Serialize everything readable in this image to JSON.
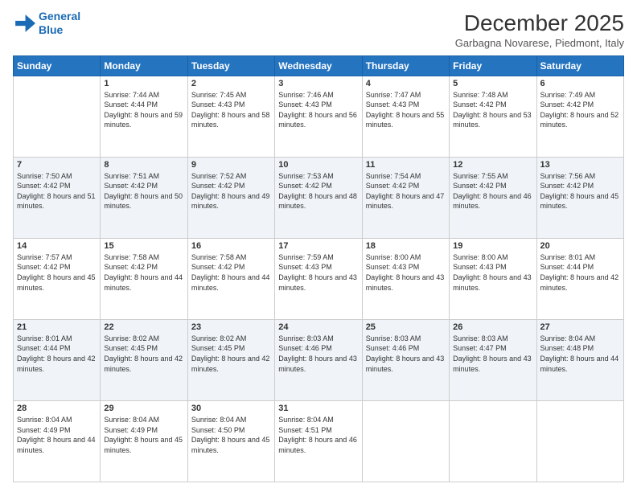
{
  "logo": {
    "line1": "General",
    "line2": "Blue"
  },
  "title": "December 2025",
  "subtitle": "Garbagna Novarese, Piedmont, Italy",
  "days_of_week": [
    "Sunday",
    "Monday",
    "Tuesday",
    "Wednesday",
    "Thursday",
    "Friday",
    "Saturday"
  ],
  "weeks": [
    [
      {
        "day": "",
        "sunrise": "",
        "sunset": "",
        "daylight": ""
      },
      {
        "day": "1",
        "sunrise": "Sunrise: 7:44 AM",
        "sunset": "Sunset: 4:44 PM",
        "daylight": "Daylight: 8 hours and 59 minutes."
      },
      {
        "day": "2",
        "sunrise": "Sunrise: 7:45 AM",
        "sunset": "Sunset: 4:43 PM",
        "daylight": "Daylight: 8 hours and 58 minutes."
      },
      {
        "day": "3",
        "sunrise": "Sunrise: 7:46 AM",
        "sunset": "Sunset: 4:43 PM",
        "daylight": "Daylight: 8 hours and 56 minutes."
      },
      {
        "day": "4",
        "sunrise": "Sunrise: 7:47 AM",
        "sunset": "Sunset: 4:43 PM",
        "daylight": "Daylight: 8 hours and 55 minutes."
      },
      {
        "day": "5",
        "sunrise": "Sunrise: 7:48 AM",
        "sunset": "Sunset: 4:42 PM",
        "daylight": "Daylight: 8 hours and 53 minutes."
      },
      {
        "day": "6",
        "sunrise": "Sunrise: 7:49 AM",
        "sunset": "Sunset: 4:42 PM",
        "daylight": "Daylight: 8 hours and 52 minutes."
      }
    ],
    [
      {
        "day": "7",
        "sunrise": "Sunrise: 7:50 AM",
        "sunset": "Sunset: 4:42 PM",
        "daylight": "Daylight: 8 hours and 51 minutes."
      },
      {
        "day": "8",
        "sunrise": "Sunrise: 7:51 AM",
        "sunset": "Sunset: 4:42 PM",
        "daylight": "Daylight: 8 hours and 50 minutes."
      },
      {
        "day": "9",
        "sunrise": "Sunrise: 7:52 AM",
        "sunset": "Sunset: 4:42 PM",
        "daylight": "Daylight: 8 hours and 49 minutes."
      },
      {
        "day": "10",
        "sunrise": "Sunrise: 7:53 AM",
        "sunset": "Sunset: 4:42 PM",
        "daylight": "Daylight: 8 hours and 48 minutes."
      },
      {
        "day": "11",
        "sunrise": "Sunrise: 7:54 AM",
        "sunset": "Sunset: 4:42 PM",
        "daylight": "Daylight: 8 hours and 47 minutes."
      },
      {
        "day": "12",
        "sunrise": "Sunrise: 7:55 AM",
        "sunset": "Sunset: 4:42 PM",
        "daylight": "Daylight: 8 hours and 46 minutes."
      },
      {
        "day": "13",
        "sunrise": "Sunrise: 7:56 AM",
        "sunset": "Sunset: 4:42 PM",
        "daylight": "Daylight: 8 hours and 45 minutes."
      }
    ],
    [
      {
        "day": "14",
        "sunrise": "Sunrise: 7:57 AM",
        "sunset": "Sunset: 4:42 PM",
        "daylight": "Daylight: 8 hours and 45 minutes."
      },
      {
        "day": "15",
        "sunrise": "Sunrise: 7:58 AM",
        "sunset": "Sunset: 4:42 PM",
        "daylight": "Daylight: 8 hours and 44 minutes."
      },
      {
        "day": "16",
        "sunrise": "Sunrise: 7:58 AM",
        "sunset": "Sunset: 4:42 PM",
        "daylight": "Daylight: 8 hours and 44 minutes."
      },
      {
        "day": "17",
        "sunrise": "Sunrise: 7:59 AM",
        "sunset": "Sunset: 4:43 PM",
        "daylight": "Daylight: 8 hours and 43 minutes."
      },
      {
        "day": "18",
        "sunrise": "Sunrise: 8:00 AM",
        "sunset": "Sunset: 4:43 PM",
        "daylight": "Daylight: 8 hours and 43 minutes."
      },
      {
        "day": "19",
        "sunrise": "Sunrise: 8:00 AM",
        "sunset": "Sunset: 4:43 PM",
        "daylight": "Daylight: 8 hours and 43 minutes."
      },
      {
        "day": "20",
        "sunrise": "Sunrise: 8:01 AM",
        "sunset": "Sunset: 4:44 PM",
        "daylight": "Daylight: 8 hours and 42 minutes."
      }
    ],
    [
      {
        "day": "21",
        "sunrise": "Sunrise: 8:01 AM",
        "sunset": "Sunset: 4:44 PM",
        "daylight": "Daylight: 8 hours and 42 minutes."
      },
      {
        "day": "22",
        "sunrise": "Sunrise: 8:02 AM",
        "sunset": "Sunset: 4:45 PM",
        "daylight": "Daylight: 8 hours and 42 minutes."
      },
      {
        "day": "23",
        "sunrise": "Sunrise: 8:02 AM",
        "sunset": "Sunset: 4:45 PM",
        "daylight": "Daylight: 8 hours and 42 minutes."
      },
      {
        "day": "24",
        "sunrise": "Sunrise: 8:03 AM",
        "sunset": "Sunset: 4:46 PM",
        "daylight": "Daylight: 8 hours and 43 minutes."
      },
      {
        "day": "25",
        "sunrise": "Sunrise: 8:03 AM",
        "sunset": "Sunset: 4:46 PM",
        "daylight": "Daylight: 8 hours and 43 minutes."
      },
      {
        "day": "26",
        "sunrise": "Sunrise: 8:03 AM",
        "sunset": "Sunset: 4:47 PM",
        "daylight": "Daylight: 8 hours and 43 minutes."
      },
      {
        "day": "27",
        "sunrise": "Sunrise: 8:04 AM",
        "sunset": "Sunset: 4:48 PM",
        "daylight": "Daylight: 8 hours and 44 minutes."
      }
    ],
    [
      {
        "day": "28",
        "sunrise": "Sunrise: 8:04 AM",
        "sunset": "Sunset: 4:49 PM",
        "daylight": "Daylight: 8 hours and 44 minutes."
      },
      {
        "day": "29",
        "sunrise": "Sunrise: 8:04 AM",
        "sunset": "Sunset: 4:49 PM",
        "daylight": "Daylight: 8 hours and 45 minutes."
      },
      {
        "day": "30",
        "sunrise": "Sunrise: 8:04 AM",
        "sunset": "Sunset: 4:50 PM",
        "daylight": "Daylight: 8 hours and 45 minutes."
      },
      {
        "day": "31",
        "sunrise": "Sunrise: 8:04 AM",
        "sunset": "Sunset: 4:51 PM",
        "daylight": "Daylight: 8 hours and 46 minutes."
      },
      {
        "day": "",
        "sunrise": "",
        "sunset": "",
        "daylight": ""
      },
      {
        "day": "",
        "sunrise": "",
        "sunset": "",
        "daylight": ""
      },
      {
        "day": "",
        "sunrise": "",
        "sunset": "",
        "daylight": ""
      }
    ]
  ]
}
